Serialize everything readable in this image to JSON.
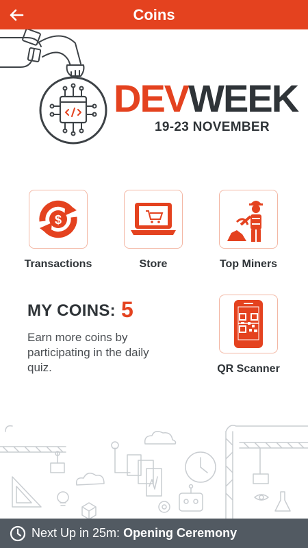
{
  "appbar": {
    "title": "Coins",
    "back_icon": "arrow-left-icon"
  },
  "branding": {
    "logo_dev": "DEV",
    "logo_week": "WEEK",
    "dates": "19-23 NOVEMBER"
  },
  "tiles": {
    "transactions": {
      "label": "Transactions",
      "icon": "dollar-cycle-icon"
    },
    "store": {
      "label": "Store",
      "icon": "laptop-cart-icon"
    },
    "top_miners": {
      "label": "Top Miners",
      "icon": "miner-icon"
    },
    "qr_scanner": {
      "label": "QR Scanner",
      "icon": "phone-qr-icon"
    }
  },
  "coins": {
    "heading": "MY COINS:",
    "value": "5",
    "description": "Earn more coins by participating in the daily quiz."
  },
  "next_up": {
    "prefix": "Next Up in 25m:",
    "event": "Opening Ceremony",
    "icon": "clock-icon"
  },
  "colors": {
    "accent": "#e4421f",
    "dark": "#2f3438",
    "bottom_bar": "#525a62",
    "tile_border": "#f3b7a4"
  }
}
